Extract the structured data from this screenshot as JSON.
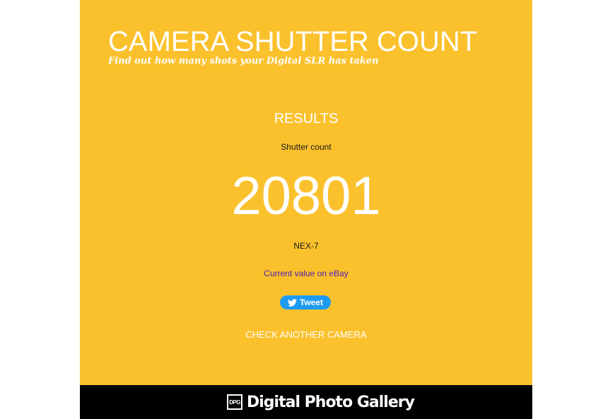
{
  "header": {
    "title": "CAMERA SHUTTER COUNT",
    "tagline": "Find out how many shots your Digital SLR has taken"
  },
  "results": {
    "heading": "RESULTS",
    "count_label": "Shutter count",
    "count_value": "20801",
    "model": "NEX-7",
    "ebay_link": "Current value on eBay",
    "tweet_label": "Tweet",
    "check_another": "CHECK ANOTHER CAMERA"
  },
  "footer": {
    "logo_mark": "DPG",
    "logo_text": "Digital Photo Gallery"
  },
  "colors": {
    "background": "#fbc12d",
    "footer": "#000000",
    "link": "#4a1bb0",
    "tweet": "#1d9bf0"
  }
}
